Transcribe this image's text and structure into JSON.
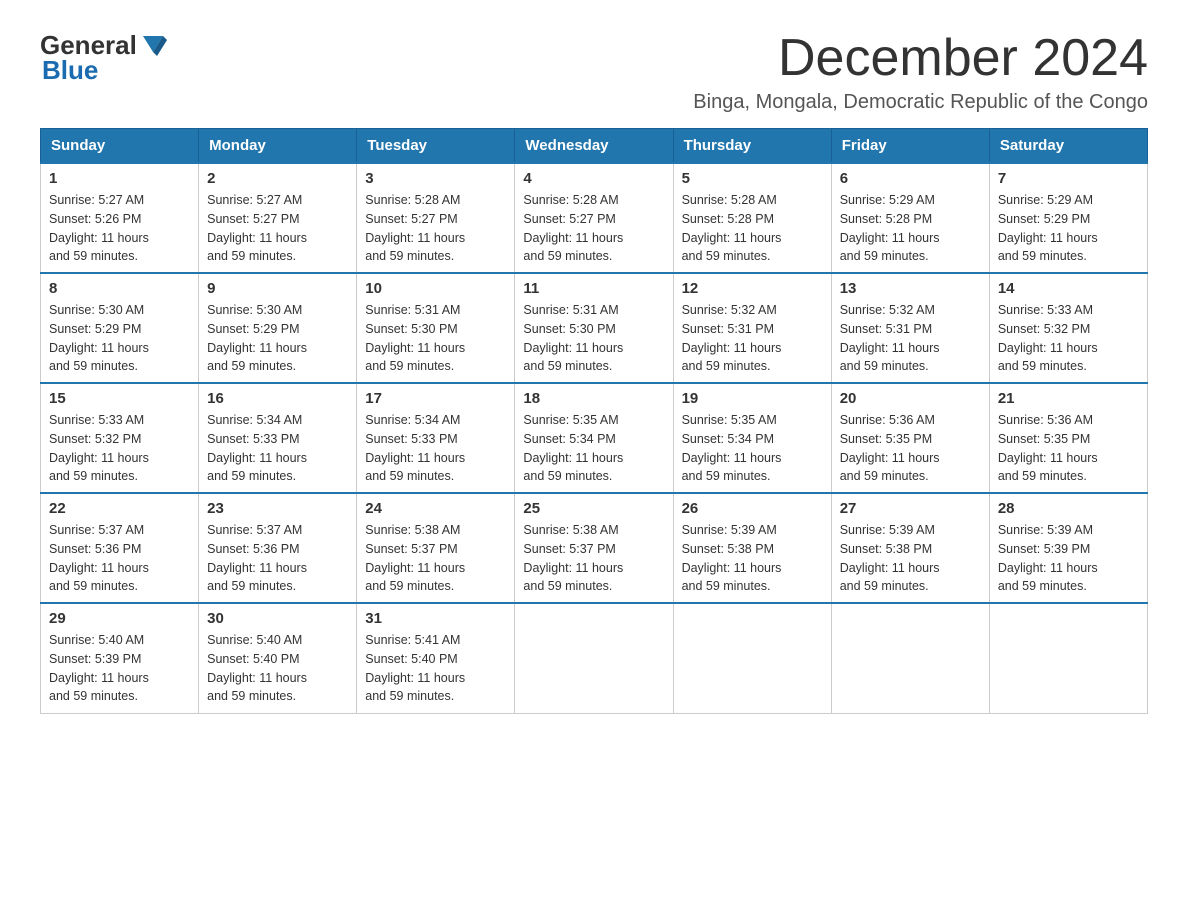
{
  "header": {
    "logo_general": "General",
    "logo_blue": "Blue",
    "month_title": "December 2024",
    "location": "Binga, Mongala, Democratic Republic of the Congo"
  },
  "days_of_week": [
    "Sunday",
    "Monday",
    "Tuesday",
    "Wednesday",
    "Thursday",
    "Friday",
    "Saturday"
  ],
  "weeks": [
    [
      {
        "day": "1",
        "sunrise": "5:27 AM",
        "sunset": "5:26 PM",
        "daylight": "11 hours and 59 minutes."
      },
      {
        "day": "2",
        "sunrise": "5:27 AM",
        "sunset": "5:27 PM",
        "daylight": "11 hours and 59 minutes."
      },
      {
        "day": "3",
        "sunrise": "5:28 AM",
        "sunset": "5:27 PM",
        "daylight": "11 hours and 59 minutes."
      },
      {
        "day": "4",
        "sunrise": "5:28 AM",
        "sunset": "5:27 PM",
        "daylight": "11 hours and 59 minutes."
      },
      {
        "day": "5",
        "sunrise": "5:28 AM",
        "sunset": "5:28 PM",
        "daylight": "11 hours and 59 minutes."
      },
      {
        "day": "6",
        "sunrise": "5:29 AM",
        "sunset": "5:28 PM",
        "daylight": "11 hours and 59 minutes."
      },
      {
        "day": "7",
        "sunrise": "5:29 AM",
        "sunset": "5:29 PM",
        "daylight": "11 hours and 59 minutes."
      }
    ],
    [
      {
        "day": "8",
        "sunrise": "5:30 AM",
        "sunset": "5:29 PM",
        "daylight": "11 hours and 59 minutes."
      },
      {
        "day": "9",
        "sunrise": "5:30 AM",
        "sunset": "5:29 PM",
        "daylight": "11 hours and 59 minutes."
      },
      {
        "day": "10",
        "sunrise": "5:31 AM",
        "sunset": "5:30 PM",
        "daylight": "11 hours and 59 minutes."
      },
      {
        "day": "11",
        "sunrise": "5:31 AM",
        "sunset": "5:30 PM",
        "daylight": "11 hours and 59 minutes."
      },
      {
        "day": "12",
        "sunrise": "5:32 AM",
        "sunset": "5:31 PM",
        "daylight": "11 hours and 59 minutes."
      },
      {
        "day": "13",
        "sunrise": "5:32 AM",
        "sunset": "5:31 PM",
        "daylight": "11 hours and 59 minutes."
      },
      {
        "day": "14",
        "sunrise": "5:33 AM",
        "sunset": "5:32 PM",
        "daylight": "11 hours and 59 minutes."
      }
    ],
    [
      {
        "day": "15",
        "sunrise": "5:33 AM",
        "sunset": "5:32 PM",
        "daylight": "11 hours and 59 minutes."
      },
      {
        "day": "16",
        "sunrise": "5:34 AM",
        "sunset": "5:33 PM",
        "daylight": "11 hours and 59 minutes."
      },
      {
        "day": "17",
        "sunrise": "5:34 AM",
        "sunset": "5:33 PM",
        "daylight": "11 hours and 59 minutes."
      },
      {
        "day": "18",
        "sunrise": "5:35 AM",
        "sunset": "5:34 PM",
        "daylight": "11 hours and 59 minutes."
      },
      {
        "day": "19",
        "sunrise": "5:35 AM",
        "sunset": "5:34 PM",
        "daylight": "11 hours and 59 minutes."
      },
      {
        "day": "20",
        "sunrise": "5:36 AM",
        "sunset": "5:35 PM",
        "daylight": "11 hours and 59 minutes."
      },
      {
        "day": "21",
        "sunrise": "5:36 AM",
        "sunset": "5:35 PM",
        "daylight": "11 hours and 59 minutes."
      }
    ],
    [
      {
        "day": "22",
        "sunrise": "5:37 AM",
        "sunset": "5:36 PM",
        "daylight": "11 hours and 59 minutes."
      },
      {
        "day": "23",
        "sunrise": "5:37 AM",
        "sunset": "5:36 PM",
        "daylight": "11 hours and 59 minutes."
      },
      {
        "day": "24",
        "sunrise": "5:38 AM",
        "sunset": "5:37 PM",
        "daylight": "11 hours and 59 minutes."
      },
      {
        "day": "25",
        "sunrise": "5:38 AM",
        "sunset": "5:37 PM",
        "daylight": "11 hours and 59 minutes."
      },
      {
        "day": "26",
        "sunrise": "5:39 AM",
        "sunset": "5:38 PM",
        "daylight": "11 hours and 59 minutes."
      },
      {
        "day": "27",
        "sunrise": "5:39 AM",
        "sunset": "5:38 PM",
        "daylight": "11 hours and 59 minutes."
      },
      {
        "day": "28",
        "sunrise": "5:39 AM",
        "sunset": "5:39 PM",
        "daylight": "11 hours and 59 minutes."
      }
    ],
    [
      {
        "day": "29",
        "sunrise": "5:40 AM",
        "sunset": "5:39 PM",
        "daylight": "11 hours and 59 minutes."
      },
      {
        "day": "30",
        "sunrise": "5:40 AM",
        "sunset": "5:40 PM",
        "daylight": "11 hours and 59 minutes."
      },
      {
        "day": "31",
        "sunrise": "5:41 AM",
        "sunset": "5:40 PM",
        "daylight": "11 hours and 59 minutes."
      },
      null,
      null,
      null,
      null
    ]
  ],
  "labels": {
    "sunrise": "Sunrise:",
    "sunset": "Sunset:",
    "daylight": "Daylight:"
  }
}
